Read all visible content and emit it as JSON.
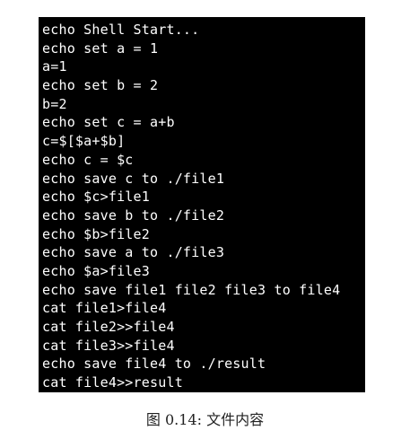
{
  "terminal": {
    "lines": [
      "echo Shell Start...",
      "echo set a = 1",
      "a=1",
      "echo set b = 2",
      "b=2",
      "echo set c = a+b",
      "c=$[$a+$b]",
      "echo c = $c",
      "echo save c to ./file1",
      "echo $c>file1",
      "echo save b to ./file2",
      "echo $b>file2",
      "echo save a to ./file3",
      "echo $a>file3",
      "echo save file1 file2 file3 to file4",
      "cat file1>file4",
      "cat file2>>file4",
      "cat file3>>file4",
      "echo save file4 to ./result",
      "cat file4>>result"
    ]
  },
  "caption": {
    "text": "图 0.14: 文件内容"
  }
}
